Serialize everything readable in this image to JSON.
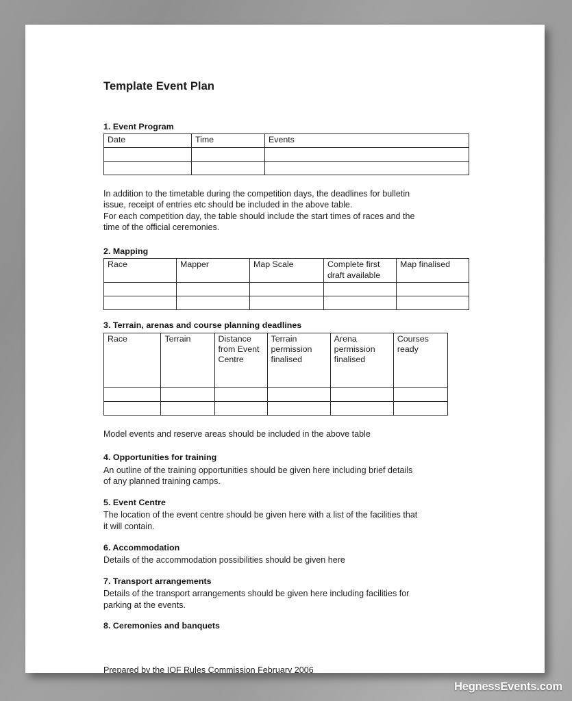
{
  "document": {
    "title": "Template Event Plan",
    "footer_note": "Prepared by the IOF Rules Commission February 2006"
  },
  "sections": {
    "s1": {
      "heading": "1. Event Program",
      "table": {
        "headers": [
          "Date",
          "Time",
          "Events"
        ],
        "empty_rows": 2
      },
      "paragraph": "In addition to the timetable during the competition days, the deadlines for bulletin issue, receipt of entries etc should be included in the above table.\nFor each competition day, the table should include the start times of races and the time of the official ceremonies.",
      "paragraph_line1": "In addition to the timetable during the competition days, the deadlines for bulletin",
      "paragraph_line2": "issue, receipt of entries etc should be included in the above table.",
      "paragraph_line3": "For each competition day, the table should include the start times of races and the",
      "paragraph_line4": "time of the official ceremonies."
    },
    "s2": {
      "heading": "2. Mapping",
      "table": {
        "headers": [
          "Race",
          "Mapper",
          "Map Scale",
          "Complete first draft available",
          "Map finalised"
        ],
        "header_c4_line1": "Complete  first",
        "header_c4_line2": "draft available",
        "empty_rows": 2
      }
    },
    "s3": {
      "heading": "3. Terrain, arenas and course planning deadlines",
      "table": {
        "headers": [
          "Race",
          "Terrain",
          "Distance from Event Centre",
          "Terrain permission finalised",
          "Arena permission finalised",
          "Courses ready"
        ],
        "empty_rows": 2
      },
      "note": "Model events and reserve areas should be included in the above table"
    },
    "s4": {
      "heading": "4. Opportunities for training",
      "body_line1": "An outline of the training opportunities should be given here including brief details",
      "body_line2": "of any planned training camps."
    },
    "s5": {
      "heading": "5. Event Centre",
      "body_line1": "The location of the event centre should be given here with a list of the facilities that",
      "body_line2": "it will contain."
    },
    "s6": {
      "heading": "6. Accommodation",
      "body_line1": "Details of the accommodation possibilities should be given here"
    },
    "s7": {
      "heading": "7. Transport arrangements",
      "body_line1": "Details of the transport arrangements should be given here including facilities for",
      "body_line2": "parking at the events."
    },
    "s8": {
      "heading": "8. Ceremonies and banquets"
    }
  },
  "watermark": {
    "text": "HegnessEvents.com"
  },
  "colors": {
    "page_background": "#ffffff",
    "canvas_background": "#9b9b9b",
    "text": "#1d1d1d",
    "table_border": "#2a2a2a",
    "watermark": "#ffffff"
  }
}
